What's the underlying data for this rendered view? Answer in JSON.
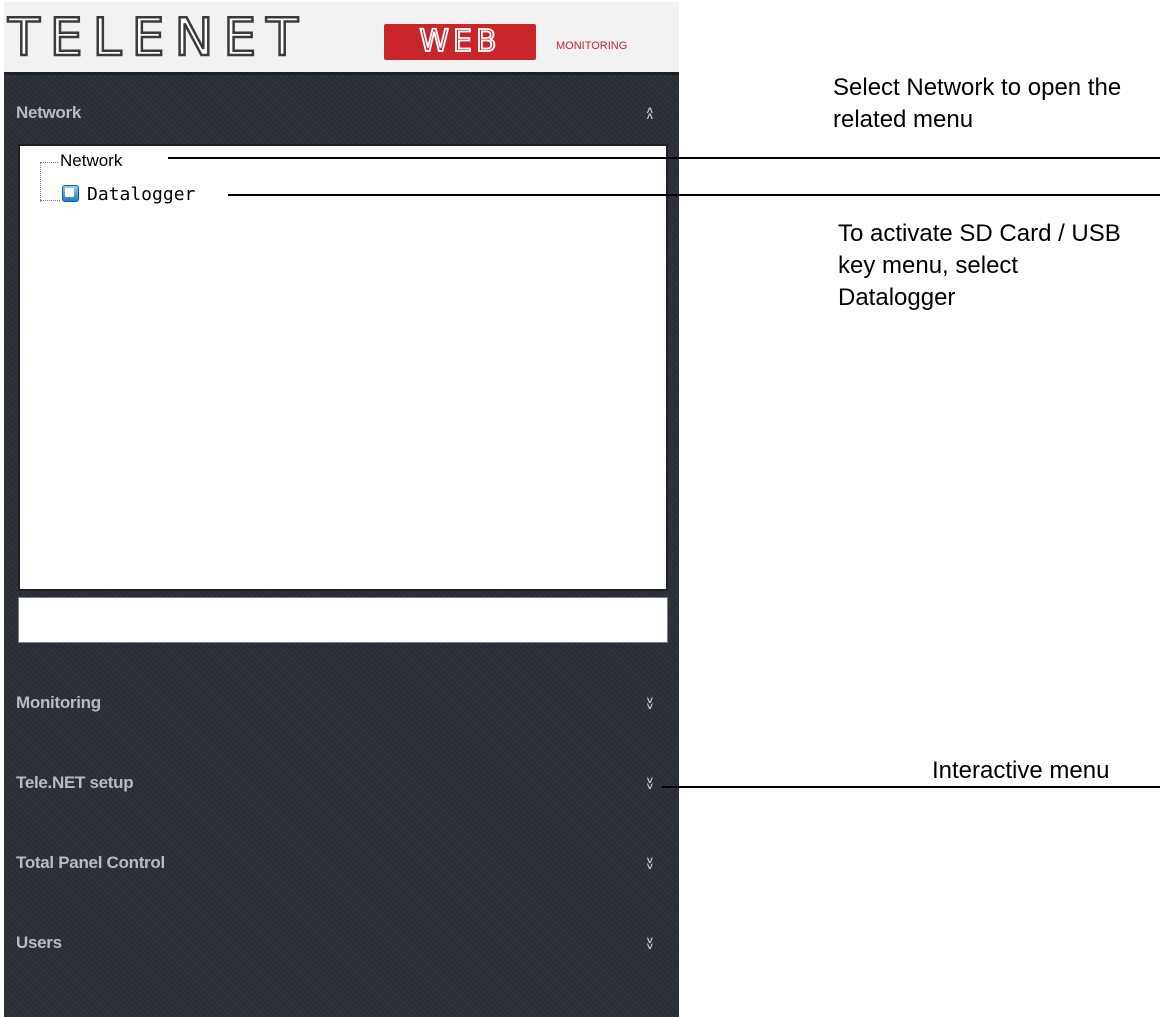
{
  "logo": {
    "primary": "TELENET",
    "badge": "WEB",
    "tagline": "MONITORING"
  },
  "sidebar": {
    "sections": [
      {
        "label": "Network",
        "state": "expanded",
        "chevron": "double-chevron-up-icon"
      },
      {
        "label": "Monitoring",
        "state": "collapsed",
        "chevron": "double-chevron-down-icon"
      },
      {
        "label": "Tele.NET setup",
        "state": "collapsed",
        "chevron": "double-chevron-down-icon"
      },
      {
        "label": "Total Panel Control",
        "state": "collapsed",
        "chevron": "double-chevron-down-icon"
      },
      {
        "label": "Users",
        "state": "collapsed",
        "chevron": "double-chevron-down-icon"
      }
    ],
    "chevron_up": "˄\n˄",
    "chevron_down": "˅\n˅"
  },
  "tree": {
    "root": "Network",
    "children": [
      {
        "label": "Datalogger",
        "icon": "datalogger-device-icon"
      }
    ]
  },
  "search": {
    "value": "",
    "placeholder": ""
  },
  "annotations": {
    "network": "Select Network to open the related menu",
    "datalogger": "To activate SD Card / USB key menu, select Datalogger",
    "interactive": "Interactive menu"
  },
  "colors": {
    "panel_bg": "#2b3036",
    "section_text": "#b8bcc1",
    "brand_red": "#c8262b"
  }
}
